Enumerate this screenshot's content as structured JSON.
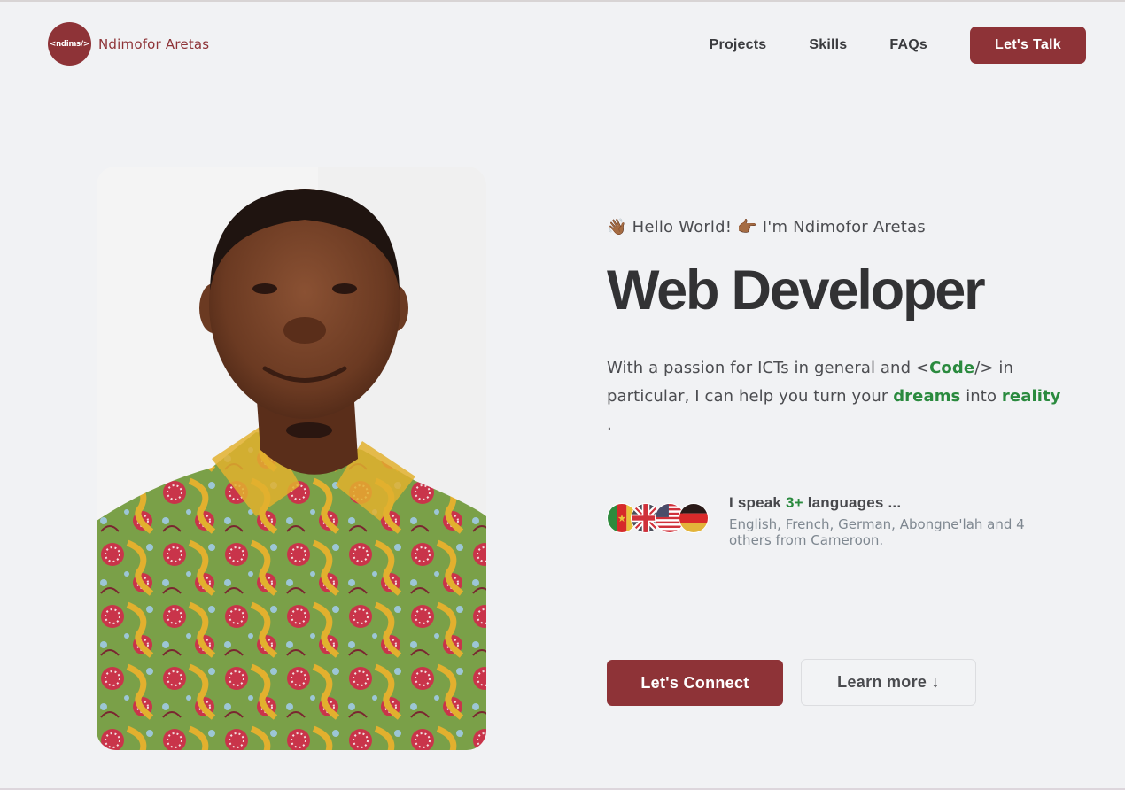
{
  "header": {
    "logo_text": "<ndims/>",
    "brand_name": "Ndimofor Aretas",
    "nav": [
      {
        "label": "Projects"
      },
      {
        "label": "Skills"
      },
      {
        "label": "FAQs"
      }
    ],
    "cta_label": "Let's Talk"
  },
  "hero": {
    "greeting_wave_emoji": "👋🏾",
    "greeting_hello": "Hello World!",
    "greeting_point_emoji": "👉🏾",
    "greeting_name": "I'm Ndimofor Aretas",
    "title": "Web Developer",
    "desc_part1": "With a passion for ICTs in general and <",
    "desc_code": "Code",
    "desc_part2": "/> in particular, I can help you turn your ",
    "desc_dreams": "dreams",
    "desc_part3": " into ",
    "desc_reality": "reality",
    "desc_part4": " .",
    "photo_alt": "Portrait of Ndimofor Aretas"
  },
  "languages": {
    "head_prefix": "I speak ",
    "head_count": "3+",
    "head_suffix": " languages ...",
    "sub": "English, French, German, Abongne'lah and 4 others from Cameroon.",
    "flags": [
      "cameroon-flag",
      "uk-flag",
      "usa-flag",
      "germany-flag"
    ]
  },
  "actions": {
    "connect_label": "Let's Connect",
    "learn_label": "Learn more ↓"
  },
  "colors": {
    "brand": "#8e3337",
    "accent_green": "#2a8a3e",
    "background": "#f1f2f4",
    "text": "#323234"
  }
}
